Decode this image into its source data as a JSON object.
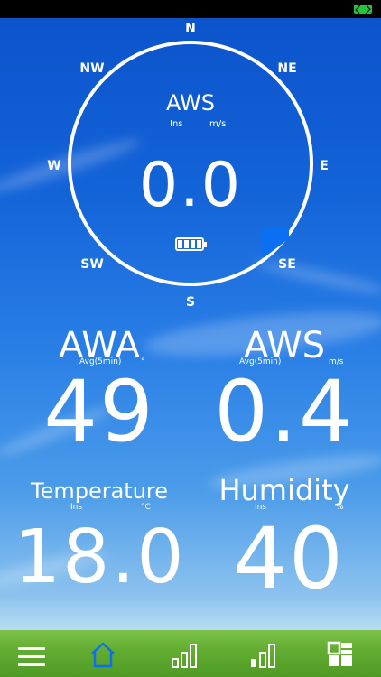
{
  "compass": {
    "north": "N",
    "north_east": "NE",
    "east": "E",
    "south_east": "SE",
    "south": "S",
    "south_west": "SW",
    "west": "W",
    "north_west": "NW"
  },
  "dial": {
    "title": "AWS",
    "left_sub": "Ins",
    "right_sub": "m/s",
    "value": "0.0",
    "battery_level": 1.0,
    "pointer_color": "#0a6ff2"
  },
  "metrics": {
    "awa": {
      "title": "AWA",
      "sub": "Avg(5min)",
      "unit": "°",
      "value": "49"
    },
    "aws": {
      "title": "AWS",
      "sub": "Avg(5min)",
      "unit": "m/s",
      "value": "0.4"
    },
    "temperature": {
      "title": "Temperature",
      "sub": "Ins",
      "unit": "°C",
      "value": "18.0"
    },
    "humidity": {
      "title": "Humidity",
      "sub": "Ins",
      "unit": "%",
      "value": "40"
    }
  },
  "bottom_nav": {
    "items": [
      {
        "name": "menu",
        "icon": "menu-icon",
        "active": false
      },
      {
        "name": "home",
        "icon": "home-icon",
        "active": true
      },
      {
        "name": "signal-1",
        "icon": "bar-chart-icon",
        "active": false
      },
      {
        "name": "signal-2",
        "icon": "bar-chart-icon",
        "active": false
      },
      {
        "name": "grid",
        "icon": "grid-icon",
        "active": false
      }
    ]
  },
  "colors": {
    "active_tab": "#0a6ff2",
    "status_battery": "#27c13b"
  }
}
